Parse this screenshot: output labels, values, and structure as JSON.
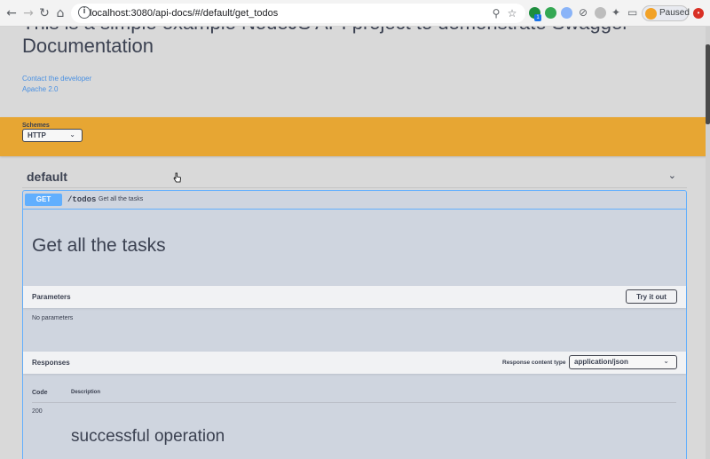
{
  "browser": {
    "url": "localhost:3080/api-docs/#/default/get_todos",
    "profile_label": "Paused",
    "icons": [
      "back-icon",
      "forward-icon",
      "reload-icon",
      "home-icon",
      "info-icon",
      "zoom-icon",
      "bookmark-star-icon",
      "extensions-icon",
      "cast-icon",
      "menu-icon"
    ],
    "badge_count": "1"
  },
  "info": {
    "title": "This is a simple example NodeJS API project to demonstrate Swagger Documentation",
    "contact_link": "Contact the developer",
    "license_link": "Apache 2.0"
  },
  "schemes": {
    "label": "Schemes",
    "selected": "HTTP"
  },
  "tag": {
    "name": "default"
  },
  "operation": {
    "method": "GET",
    "path": "/todos",
    "summary": "Get all the tasks",
    "description": "Get all the tasks",
    "parameters": {
      "title": "Parameters",
      "try_it_out": "Try it out",
      "empty_text": "No parameters"
    },
    "responses": {
      "title": "Responses",
      "content_type_label": "Response content type",
      "content_type": "application/json",
      "columns": [
        "Code",
        "Description"
      ],
      "rows": [
        {
          "code": "200",
          "description": "successful operation"
        }
      ]
    }
  },
  "colors": {
    "get": "#61affe",
    "schemes_bar": "#e7a633",
    "link": "#4990e2"
  }
}
